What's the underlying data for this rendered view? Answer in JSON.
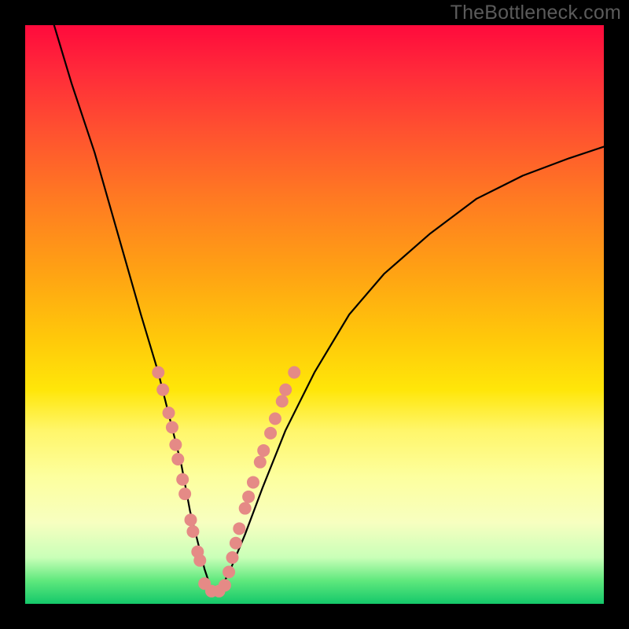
{
  "watermark": "TheBottleneck.com",
  "colors": {
    "frame_bg": "#000000",
    "dot_fill": "#e58a86",
    "curve_stroke": "#000000",
    "gradient_top": "#ff0a3c",
    "gradient_bottom": "#14c86a"
  },
  "chart_data": {
    "type": "line",
    "title": "",
    "xlabel": "",
    "ylabel": "",
    "xlim": [
      0,
      100
    ],
    "ylim": [
      0,
      100
    ],
    "grid": false,
    "legend": false,
    "series": [
      {
        "name": "bottleneck-curve",
        "x": [
          5,
          8,
          12,
          16,
          20,
          23,
          25,
          27,
          28.5,
          30,
          31,
          32,
          33,
          34,
          35.5,
          38,
          41,
          45,
          50,
          56,
          62,
          70,
          78,
          86,
          94,
          100
        ],
        "y": [
          100,
          90,
          78,
          64,
          50,
          40,
          32,
          24,
          16,
          10,
          6,
          3,
          2,
          3,
          6,
          12,
          20,
          30,
          40,
          50,
          57,
          64,
          70,
          74,
          77,
          79
        ]
      }
    ],
    "markers": [
      {
        "name": "dots-left-branch",
        "points": [
          {
            "x": 23.0,
            "y": 40.0
          },
          {
            "x": 23.8,
            "y": 37.0
          },
          {
            "x": 24.8,
            "y": 33.0
          },
          {
            "x": 25.4,
            "y": 30.5
          },
          {
            "x": 26.0,
            "y": 27.5
          },
          {
            "x": 26.4,
            "y": 25.0
          },
          {
            "x": 27.2,
            "y": 21.5
          },
          {
            "x": 27.6,
            "y": 19.0
          },
          {
            "x": 28.6,
            "y": 14.5
          },
          {
            "x": 29.0,
            "y": 12.5
          },
          {
            "x": 29.8,
            "y": 9.0
          },
          {
            "x": 30.2,
            "y": 7.5
          }
        ]
      },
      {
        "name": "dots-right-branch",
        "points": [
          {
            "x": 35.2,
            "y": 5.5
          },
          {
            "x": 35.8,
            "y": 8.0
          },
          {
            "x": 36.4,
            "y": 10.5
          },
          {
            "x": 37.0,
            "y": 13.0
          },
          {
            "x": 38.0,
            "y": 16.5
          },
          {
            "x": 38.6,
            "y": 18.5
          },
          {
            "x": 39.4,
            "y": 21.0
          },
          {
            "x": 40.6,
            "y": 24.5
          },
          {
            "x": 41.2,
            "y": 26.5
          },
          {
            "x": 42.4,
            "y": 29.5
          },
          {
            "x": 43.2,
            "y": 32.0
          },
          {
            "x": 44.4,
            "y": 35.0
          },
          {
            "x": 45.0,
            "y": 37.0
          },
          {
            "x": 46.5,
            "y": 40.0
          }
        ]
      },
      {
        "name": "dots-valley",
        "points": [
          {
            "x": 31.0,
            "y": 3.5
          },
          {
            "x": 32.2,
            "y": 2.2
          },
          {
            "x": 33.5,
            "y": 2.2
          },
          {
            "x": 34.5,
            "y": 3.2
          }
        ]
      }
    ]
  }
}
